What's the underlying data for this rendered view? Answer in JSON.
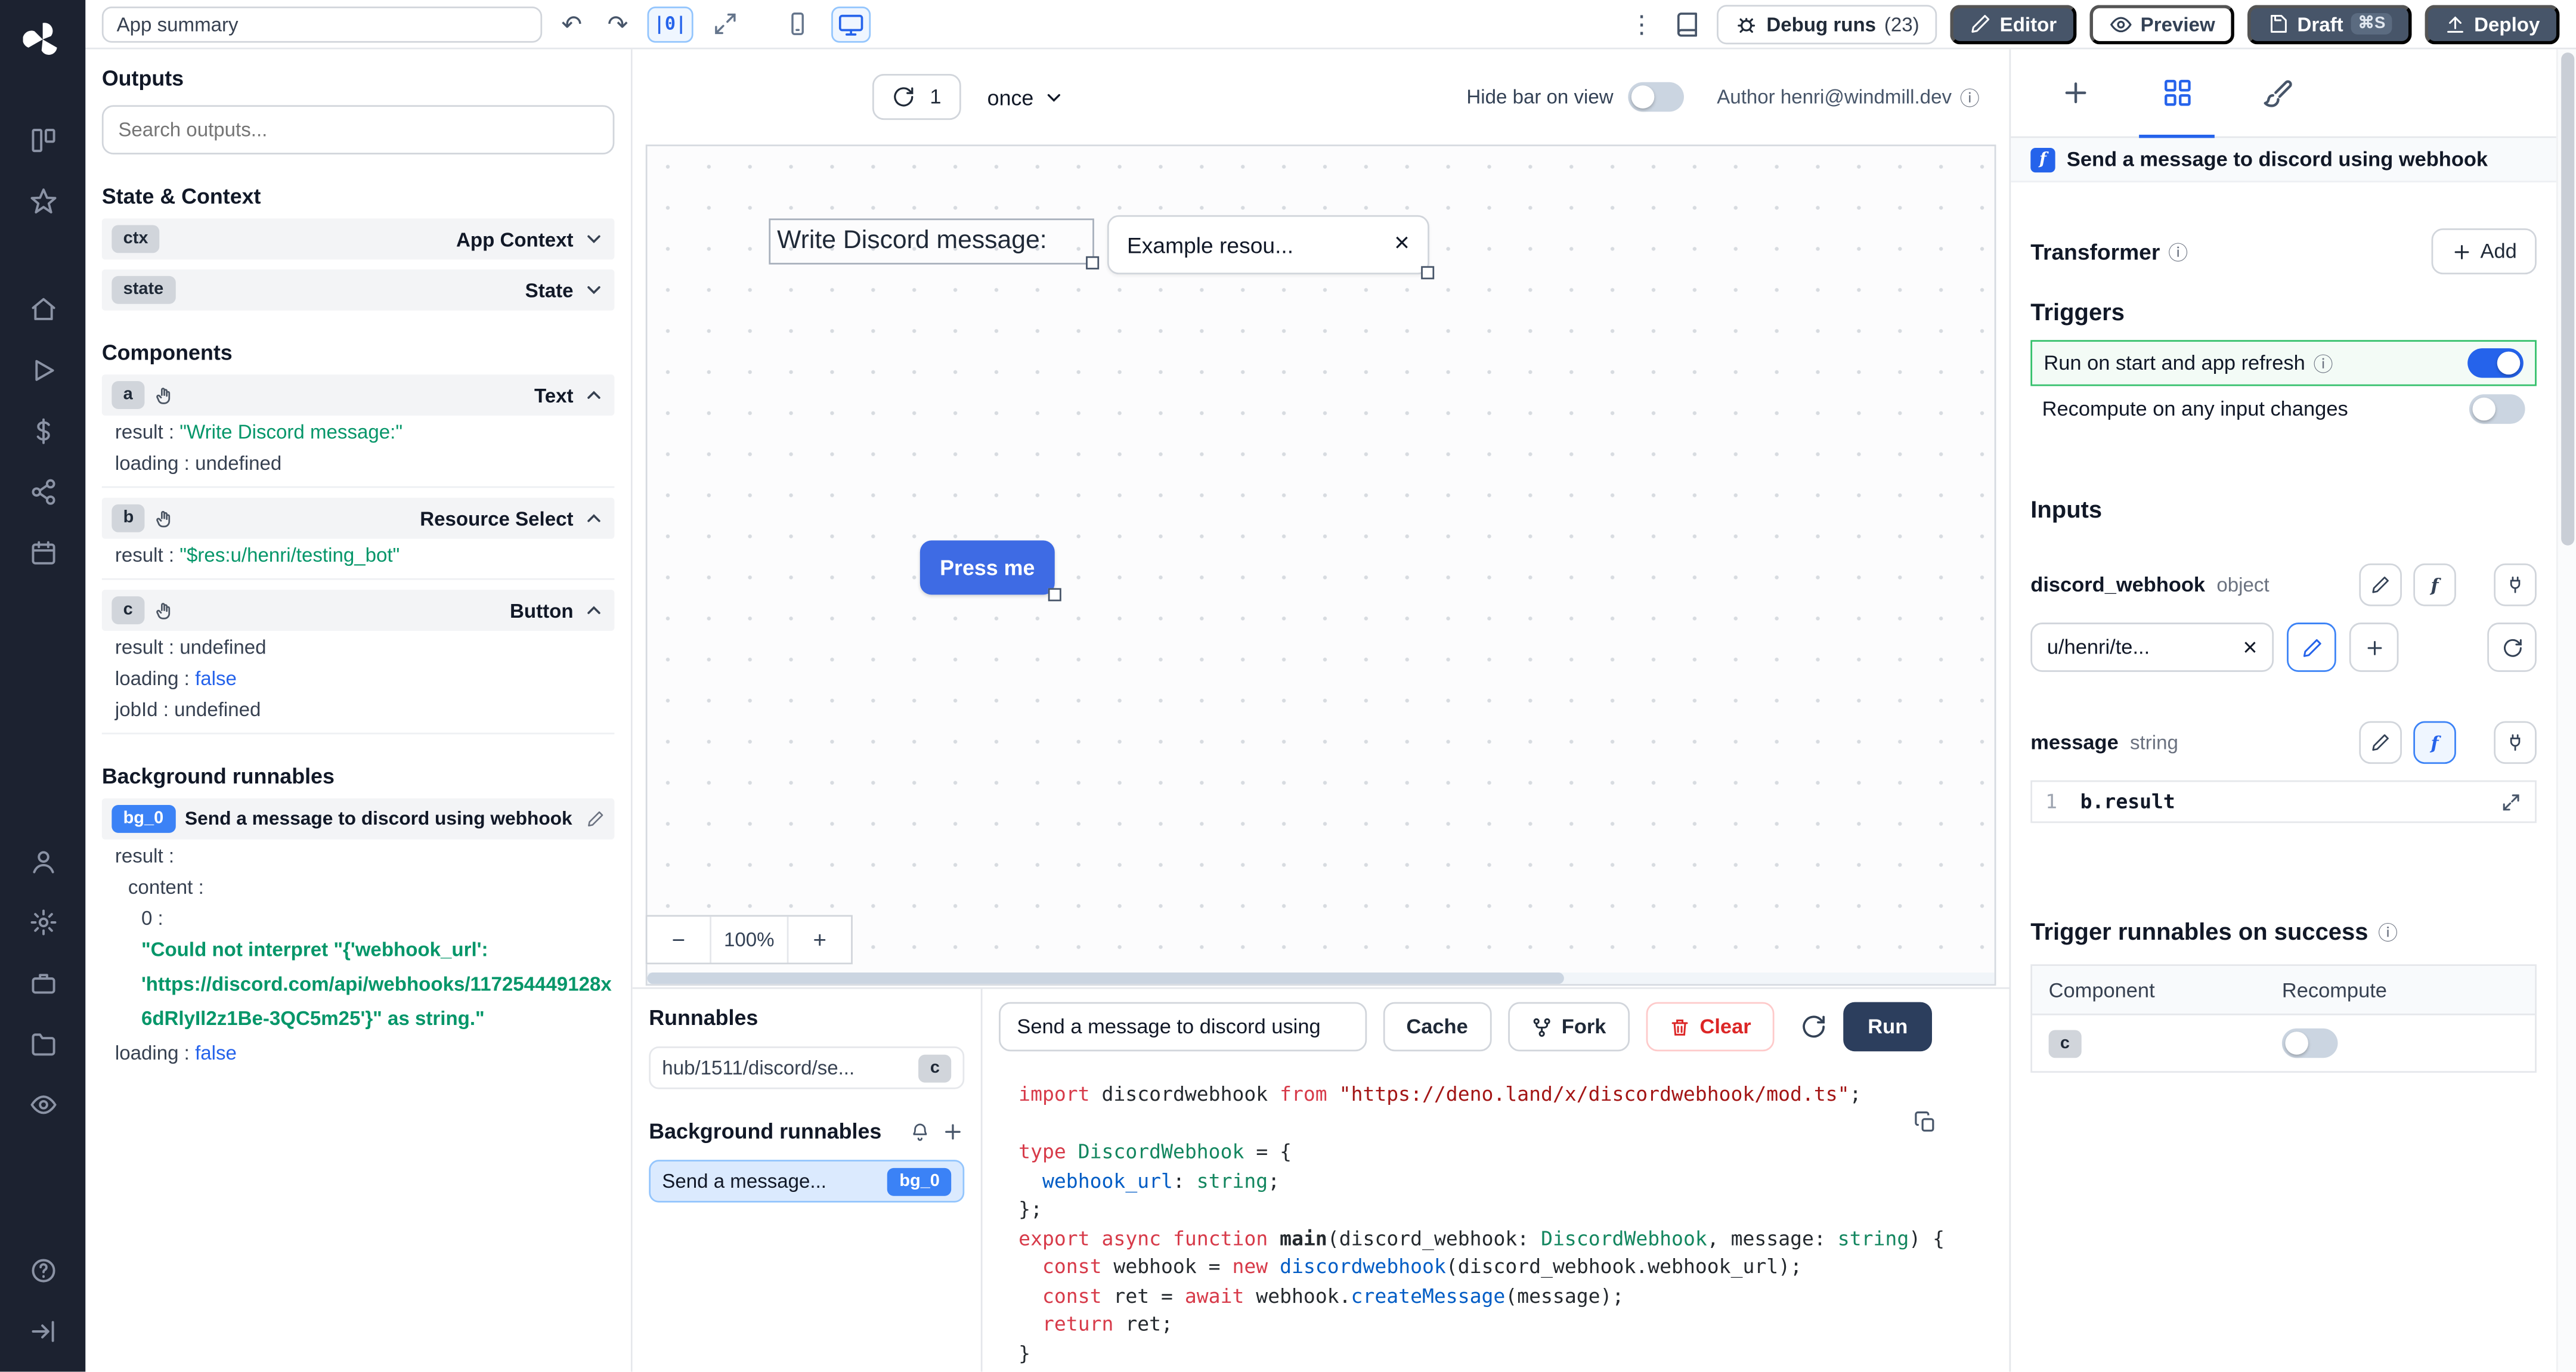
{
  "icons": {
    "undo": "↶",
    "redo": "↷",
    "kebab": "⋮",
    "info": "ⓘ",
    "close": "×",
    "minus": "−",
    "plus_txt": "+",
    "fx": "f",
    "dollar": "$"
  },
  "topbar": {
    "app_summary": "App summary",
    "panel_toggle": "|0|",
    "debug_runs": "Debug runs",
    "debug_count": "(23)",
    "editor": "Editor",
    "preview": "Preview",
    "draft": "Draft",
    "draft_shortcut": "⌘S",
    "deploy": "Deploy"
  },
  "outputs": {
    "title": "Outputs",
    "search_placeholder": "Search outputs...",
    "state_context_title": "State & Context",
    "ctx": {
      "badge": "ctx",
      "label": "App Context"
    },
    "state": {
      "badge": "state",
      "label": "State"
    },
    "components_title": "Components",
    "comp_a": {
      "badge": "a",
      "type": "Text",
      "r0k": "result",
      "r0v": "\"Write Discord message:\"",
      "r1k": "loading",
      "r1v": "undefined"
    },
    "comp_b": {
      "badge": "b",
      "type": "Resource Select",
      "r0k": "result",
      "r0v": "\"$res:u/henri/testing_bot\""
    },
    "comp_c": {
      "badge": "c",
      "type": "Button",
      "r0k": "result",
      "r0v": "undefined",
      "r1k": "loading",
      "r1v": "false",
      "r2k": "jobId",
      "r2v": "undefined"
    },
    "background_title": "Background runnables",
    "bg0": {
      "badge": "bg_0",
      "label": "Send a message to discord using webhook",
      "k_result": "result",
      "k_content": "content",
      "k_zero": "0",
      "error": "\"Could not interpret \"{'webhook_url': 'https://discord.com/api/webhooks/117254449128x6dRlyIl2z1Be-3QC5m25'}\" as string.\"",
      "k_loading": "loading",
      "v_loading": "false"
    }
  },
  "canvas": {
    "refresh_count": "1",
    "frequency": "once",
    "hide_bar": "Hide bar on view",
    "author": "Author henri@windmill.dev",
    "text_component": "Write Discord message:",
    "select_value": "Example resou...",
    "button_label": "Press me",
    "zoom_out": "−",
    "zoom_level": "100%",
    "zoom_in": "+"
  },
  "runnables": {
    "title": "Runnables",
    "item1_label": "hub/1511/discord/se...",
    "item1_badge": "c",
    "background_title": "Background runnables",
    "item2_label": "Send a message...",
    "item2_badge": "bg_0"
  },
  "editor": {
    "title": "Send a message to discord using",
    "cache": "Cache",
    "fork": "Fork",
    "clear": "Clear",
    "run": "Run",
    "code": [
      [
        {
          "t": "import",
          "c": "k"
        },
        {
          "t": " discordwebhook ",
          "c": "p"
        },
        {
          "t": "from",
          "c": "k"
        },
        {
          "t": " ",
          "c": "p"
        },
        {
          "t": "\"https://deno.land/x/discordwebhook/mod.ts\"",
          "c": "s"
        },
        {
          "t": ";",
          "c": "p"
        }
      ],
      [],
      [
        {
          "t": "type",
          "c": "k"
        },
        {
          "t": " ",
          "c": "p"
        },
        {
          "t": "DiscordWebhook",
          "c": "ty"
        },
        {
          "t": " = {",
          "c": "p"
        }
      ],
      [
        {
          "t": "  ",
          "c": "p"
        },
        {
          "t": "webhook_url",
          "c": "pr"
        },
        {
          "t": ": ",
          "c": "p"
        },
        {
          "t": "string",
          "c": "ty"
        },
        {
          "t": ";",
          "c": "p"
        }
      ],
      [
        {
          "t": "};",
          "c": "p"
        }
      ],
      [
        {
          "t": "export",
          "c": "k"
        },
        {
          "t": " ",
          "c": "p"
        },
        {
          "t": "async",
          "c": "k"
        },
        {
          "t": " ",
          "c": "p"
        },
        {
          "t": "function",
          "c": "k"
        },
        {
          "t": " ",
          "c": "p"
        },
        {
          "t": "main",
          "c": "fn"
        },
        {
          "t": "(discord_webhook: ",
          "c": "p"
        },
        {
          "t": "DiscordWebhook",
          "c": "ty"
        },
        {
          "t": ", message: ",
          "c": "p"
        },
        {
          "t": "string",
          "c": "ty"
        },
        {
          "t": ") {",
          "c": "p"
        }
      ],
      [
        {
          "t": "  ",
          "c": "p"
        },
        {
          "t": "const",
          "c": "k"
        },
        {
          "t": " webhook = ",
          "c": "p"
        },
        {
          "t": "new",
          "c": "k"
        },
        {
          "t": " ",
          "c": "p"
        },
        {
          "t": "discordwebhook",
          "c": "fn2"
        },
        {
          "t": "(discord_webhook.webhook_url);",
          "c": "p"
        }
      ],
      [
        {
          "t": "  ",
          "c": "p"
        },
        {
          "t": "const",
          "c": "k"
        },
        {
          "t": " ret = ",
          "c": "p"
        },
        {
          "t": "await",
          "c": "k"
        },
        {
          "t": " webhook.",
          "c": "p"
        },
        {
          "t": "createMessage",
          "c": "fn2"
        },
        {
          "t": "(message);",
          "c": "p"
        }
      ],
      [
        {
          "t": "  ",
          "c": "p"
        },
        {
          "t": "return",
          "c": "k"
        },
        {
          "t": " ret;",
          "c": "p"
        }
      ],
      [
        {
          "t": "}",
          "c": "p"
        }
      ]
    ]
  },
  "inspector": {
    "header": "Send a message to discord using webhook",
    "transformer": "Transformer",
    "add": "Add",
    "triggers_title": "Triggers",
    "run_on_start": "Run on start and app refresh",
    "recompute": "Recompute on any input changes",
    "inputs_title": "Inputs",
    "f1_name": "discord_webhook",
    "f1_type": "object",
    "f1_value": "u/henri/te...",
    "f2_name": "message",
    "f2_type": "string",
    "f2_lineno": "1",
    "f2_value": "b.result",
    "trigger_success": "Trigger runnables on success",
    "col_component": "Component",
    "col_recompute": "Recompute",
    "row_badge": "c"
  }
}
